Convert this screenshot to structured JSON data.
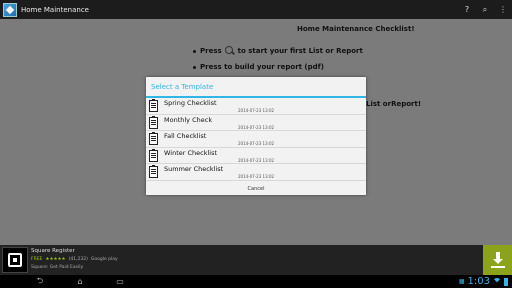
{
  "app": {
    "title": "Home Maintenance",
    "actions": [
      {
        "name": "help-icon",
        "glyph": "?"
      },
      {
        "name": "search-icon",
        "glyph": "⌕"
      },
      {
        "name": "overflow-menu-icon",
        "glyph": "⋮"
      }
    ]
  },
  "content": {
    "heading": "Home Maintenance Checklist!",
    "bullet1_a": "Press",
    "bullet1_b": "to start your first List or Report",
    "bullet2": "Press  to build your report (pdf)",
    "partial": "List orReport!"
  },
  "dialog": {
    "title": "Select a Template",
    "items": [
      {
        "name": "Spring Checklist",
        "date": "2014-07-23 13:02"
      },
      {
        "name": "Monthly Check",
        "date": "2014-07-23 13:02"
      },
      {
        "name": "Fall Checklist",
        "date": "2014-07-23 13:02"
      },
      {
        "name": "Winter Checklist",
        "date": "2014-07-23 13:02"
      },
      {
        "name": "Summer Checklist",
        "date": "2014-07-23 13:02"
      }
    ],
    "cancel": "Cancel"
  },
  "ad": {
    "title": "Square Register",
    "free": "FREE",
    "stars": "★★★★★",
    "reviews": "(41,232)",
    "store": "Google play",
    "tagline": "Square: Get Paid Easily"
  },
  "status": {
    "time": "1:03",
    "accent": "#33b5e5"
  }
}
